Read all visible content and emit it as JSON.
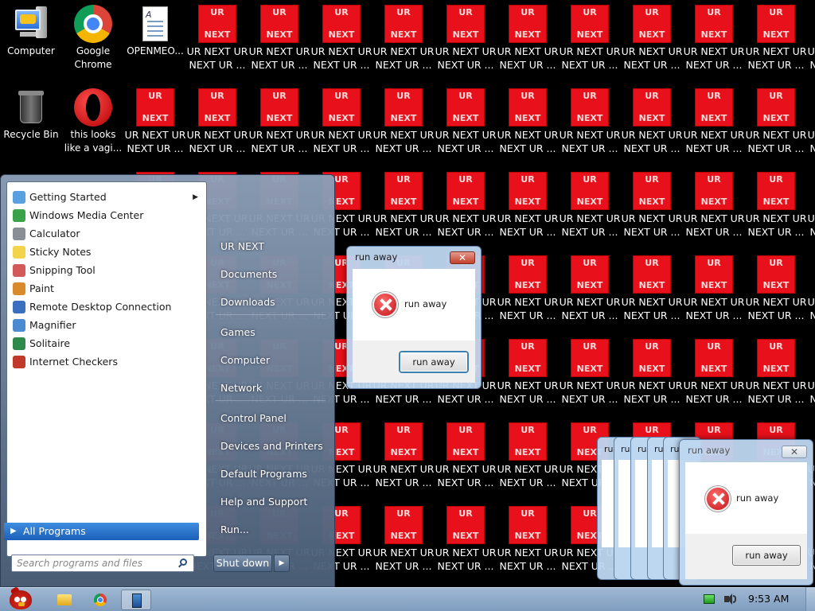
{
  "desktop": {
    "icons": [
      {
        "id": "computer",
        "label": "Computer"
      },
      {
        "id": "chrome",
        "label": "Google Chrome"
      },
      {
        "id": "openmeo",
        "label": "OPENMEO..."
      },
      {
        "id": "recycle",
        "label": "Recycle Bin"
      },
      {
        "id": "opera",
        "label": "this looks like a vagi..."
      }
    ],
    "ur_icon": {
      "top_text": "UR",
      "bottom_text": "NEXT",
      "label_line1": "UR NEXT UR",
      "label_line2": "NEXT UR ...",
      "color": "#e8101a"
    }
  },
  "start_menu": {
    "programs": [
      {
        "label": "Getting Started",
        "icon": "getting-started-icon",
        "has_submenu": true
      },
      {
        "label": "Windows Media Center",
        "icon": "media-center-icon"
      },
      {
        "label": "Calculator",
        "icon": "calculator-icon"
      },
      {
        "label": "Sticky Notes",
        "icon": "sticky-notes-icon"
      },
      {
        "label": "Snipping Tool",
        "icon": "snipping-tool-icon"
      },
      {
        "label": "Paint",
        "icon": "paint-icon"
      },
      {
        "label": "Remote Desktop Connection",
        "icon": "remote-desktop-icon"
      },
      {
        "label": "Magnifier",
        "icon": "magnifier-icon"
      },
      {
        "label": "Solitaire",
        "icon": "solitaire-icon"
      },
      {
        "label": "Internet Checkers",
        "icon": "checkers-icon"
      }
    ],
    "all_programs": "All Programs",
    "search_placeholder": "Search programs and files",
    "right_links": [
      "UR NEXT",
      "Documents",
      "Downloads",
      "Games",
      "Computer",
      "Network",
      "Control Panel",
      "Devices and Printers",
      "Default Programs",
      "Help and Support",
      "Run..."
    ],
    "shutdown": "Shut down"
  },
  "dialogs": {
    "main": {
      "title": "run away",
      "message": "run away",
      "button": "run away"
    },
    "front": {
      "title": "run away",
      "message": "run away",
      "button": "run away"
    },
    "stack_title": "ru"
  },
  "taskbar": {
    "clock": "9:53 AM"
  }
}
